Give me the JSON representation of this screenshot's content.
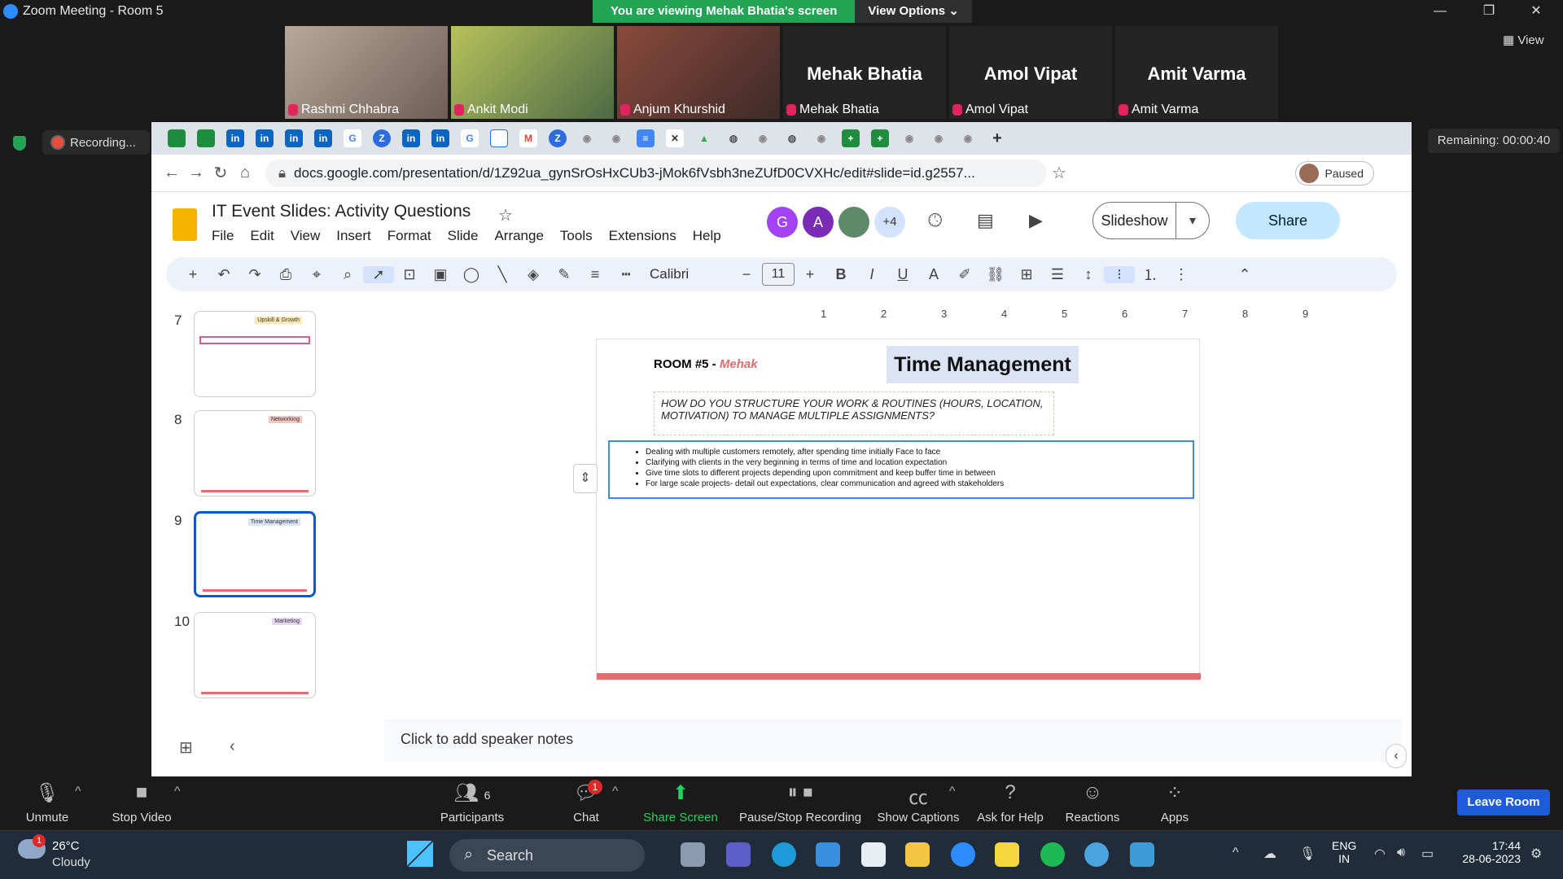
{
  "zoom": {
    "title": "Zoom Meeting - Room 5",
    "banner_text": "You are viewing Mehak Bhatia's screen",
    "view_options": "View Options",
    "view_btn": "View",
    "recording": "Recording...",
    "remaining": "Remaining: 00:00:40",
    "participants": [
      {
        "name": "Rashmi Chhabra",
        "big": ""
      },
      {
        "name": "Ankit Modi",
        "big": ""
      },
      {
        "name": "Anjum Khurshid",
        "big": ""
      },
      {
        "name": "Mehak Bhatia",
        "big": "Mehak Bhatia"
      },
      {
        "name": "Amol Vipat",
        "big": "Amol Vipat"
      },
      {
        "name": "Amit Varma",
        "big": "Amit Varma"
      }
    ],
    "controls": {
      "unmute": "Unmute",
      "stop_video": "Stop Video",
      "participants": "Participants",
      "participants_count": "6",
      "chat": "Chat",
      "chat_badge": "1",
      "share_screen": "Share Screen",
      "pause_rec": "Pause/Stop Recording",
      "captions": "Show Captions",
      "help": "Ask for Help",
      "reactions": "Reactions",
      "apps": "Apps",
      "leave": "Leave Room"
    }
  },
  "browser": {
    "url": "docs.google.com/presentation/d/1Z92ua_gynSrOsHxCUb3-jMok6fVsbh3neZUfD0CVXHc/edit#slide=id.g2557...",
    "paused": "Paused"
  },
  "docs": {
    "title": "IT Event Slides: Activity Questions",
    "menus": [
      "File",
      "Edit",
      "View",
      "Insert",
      "Format",
      "Slide",
      "Arrange",
      "Tools",
      "Extensions",
      "Help"
    ],
    "avatars": [
      {
        "letter": "G",
        "color": "#a142f4"
      },
      {
        "letter": "A",
        "color": "#7b2bb5"
      }
    ],
    "more_users": "+4",
    "slideshow": "Slideshow",
    "share": "Share",
    "font": "Calibri",
    "font_size": "11",
    "notes": "Click to add speaker notes"
  },
  "thumbs": [
    {
      "num": "7",
      "tag": "Upskill & Growth"
    },
    {
      "num": "8",
      "tag": "Networking"
    },
    {
      "num": "9",
      "tag": "Time Management"
    },
    {
      "num": "10",
      "tag": "Marketing"
    }
  ],
  "ruler_ticks": [
    "1",
    "2",
    "3",
    "4",
    "5",
    "6",
    "7",
    "8",
    "9"
  ],
  "slide": {
    "room_prefix": "ROOM #5 - ",
    "room_name": "Mehak",
    "title": "Time Management",
    "question": "HOW DO YOU STRUCTURE YOUR WORK & ROUTINES (HOURS, LOCATION, MOTIVATION) TO MANAGE MULTIPLE ASSIGNMENTS?",
    "bullets": [
      "Dealing with multiple customers remotely, after spending time initially Face to face",
      "Clarifying with clients in the very beginning in terms of time and location expectation",
      "Give time slots to different projects depending upon commitment and keep buffer time in between",
      "For large scale projects- detail out expectations, clear communication and agreed with stakeholders"
    ]
  },
  "taskbar": {
    "weather_temp": "26°C",
    "weather_desc": "Cloudy",
    "weather_badge": "1",
    "search": "Search",
    "lang1": "ENG",
    "lang2": "IN",
    "time": "17:44",
    "date": "28-06-2023"
  }
}
